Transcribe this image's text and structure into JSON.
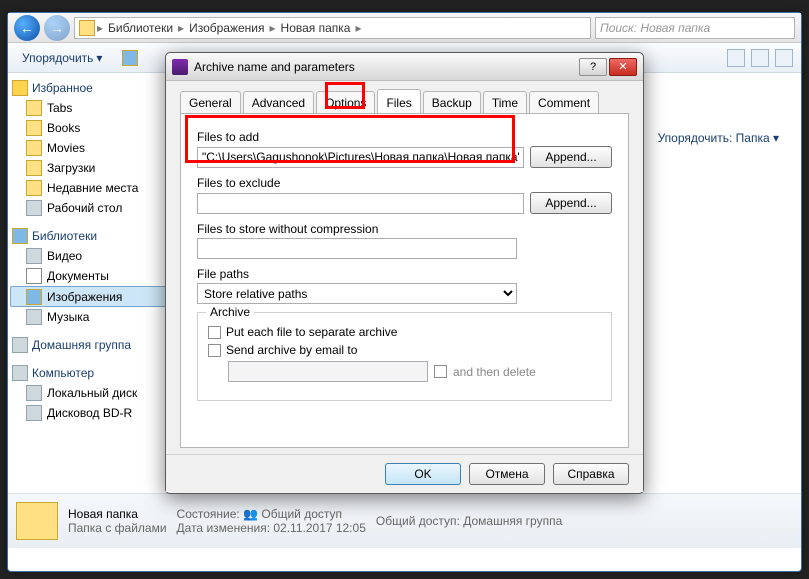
{
  "explorer": {
    "breadcrumbs": [
      "Библиотеки",
      "Изображения",
      "Новая папка"
    ],
    "search_placeholder": "Поиск: Новая папка",
    "toolbar": {
      "organize": "Упорядочить"
    },
    "sort_label": "Упорядочить:",
    "sort_value": "Папка",
    "sidebar": {
      "favorites": {
        "title": "Избранное",
        "items": [
          "Tabs",
          "Books",
          "Movies",
          "Загрузки",
          "Недавние места",
          "Рабочий стол"
        ]
      },
      "libraries": {
        "title": "Библиотеки",
        "items": [
          "Видео",
          "Документы",
          "Изображения",
          "Музыка"
        ],
        "selected_index": 2
      },
      "homegroup": {
        "title": "Домашняя группа"
      },
      "computer": {
        "title": "Компьютер",
        "items": [
          "Локальный диск",
          "Дисковод BD-R"
        ]
      }
    },
    "detail": {
      "name": "Новая папка",
      "type": "Папка с файлами",
      "state_label": "Состояние:",
      "state_value": "Общий доступ",
      "date_label": "Дата изменения:",
      "date_value": "02.11.2017 12:05",
      "share_label": "Общий доступ:",
      "share_value": "Домашняя группа"
    }
  },
  "dialog": {
    "title": "Archive name and parameters",
    "tabs": [
      "General",
      "Advanced",
      "Options",
      "Files",
      "Backup",
      "Time",
      "Comment"
    ],
    "active_tab_index": 3,
    "files_to_add_label": "Files to add",
    "files_to_add_value": "\"C:\\Users\\Gagushonok\\Pictures\\Новая папка\\Новая папка\"",
    "files_to_exclude_label": "Files to exclude",
    "files_to_store_label": "Files to store without compression",
    "file_paths_label": "File paths",
    "file_paths_value": "Store relative paths",
    "append_label": "Append...",
    "archive_group": "Archive",
    "cb_separate": "Put each file to separate archive",
    "cb_email": "Send archive by email to",
    "cb_then_delete": "and then delete",
    "buttons": {
      "ok": "OK",
      "cancel": "Отмена",
      "help": "Справка"
    }
  }
}
